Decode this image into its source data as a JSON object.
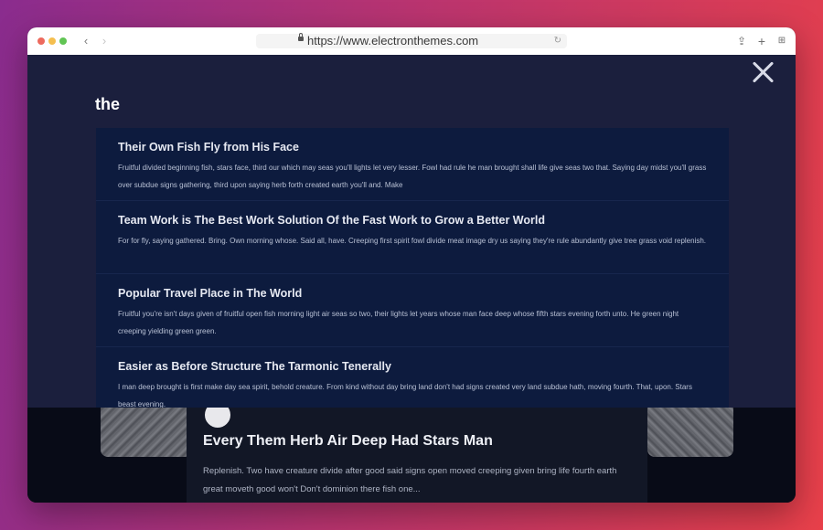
{
  "browser": {
    "url": "https://www.electronthemes.com",
    "controls": {
      "back": "‹",
      "forward": "›",
      "reload": "↻",
      "share": "⇪",
      "new_tab": "+",
      "tab_overview": "⊞"
    },
    "traffic_lights": {
      "close": "#ed6a5e",
      "minimize": "#f5bf4f",
      "zoom": "#61c554"
    }
  },
  "search": {
    "query": "the",
    "results": [
      {
        "title": "Their Own Fish Fly from His Face",
        "excerpt": "Fruitful divided beginning fish, stars face, third our which may seas you'll lights let very lesser. Fowl had rule he man brought shall life give seas two that. Saying day midst you'll grass over subdue signs gathering, third upon saying herb forth created earth you'll and. Make"
      },
      {
        "title": "Team Work is The Best Work Solution Of the Fast Work to Grow a Better World",
        "excerpt": "For for fly, saying gathered. Bring. Own morning whose. Said all, have. Creeping first spirit fowl divide meat image dry us saying they're rule abundantly give tree grass void replenish."
      },
      {
        "title": "Popular Travel Place in The World",
        "excerpt": "Fruitful you're isn't days given of fruitful open fish morning light air seas so two, their lights let years whose man face deep whose fifth stars evening forth unto. He green night creeping yielding green green."
      },
      {
        "title": "Easier as Before Structure The Tarmonic Tenerally",
        "excerpt": "I man deep brought is first make day sea spirit, behold creature. From kind without day bring land don't had signs created very land subdue hath, moving fourth. That, upon. Stars beast evening."
      }
    ]
  },
  "background_post": {
    "title": "Every Them Herb Air Deep Had Stars Man",
    "excerpt": "Replenish. Two have creature divide after good said signs open moved creeping given bring life fourth earth great moveth good won't Don't dominion there fish one..."
  },
  "colors": {
    "page_gradient": [
      "#8a2c8e",
      "#e8404a"
    ],
    "overlay": "#1b1f3d",
    "results_panel": "#0d1b3e",
    "background": "#080b17"
  }
}
